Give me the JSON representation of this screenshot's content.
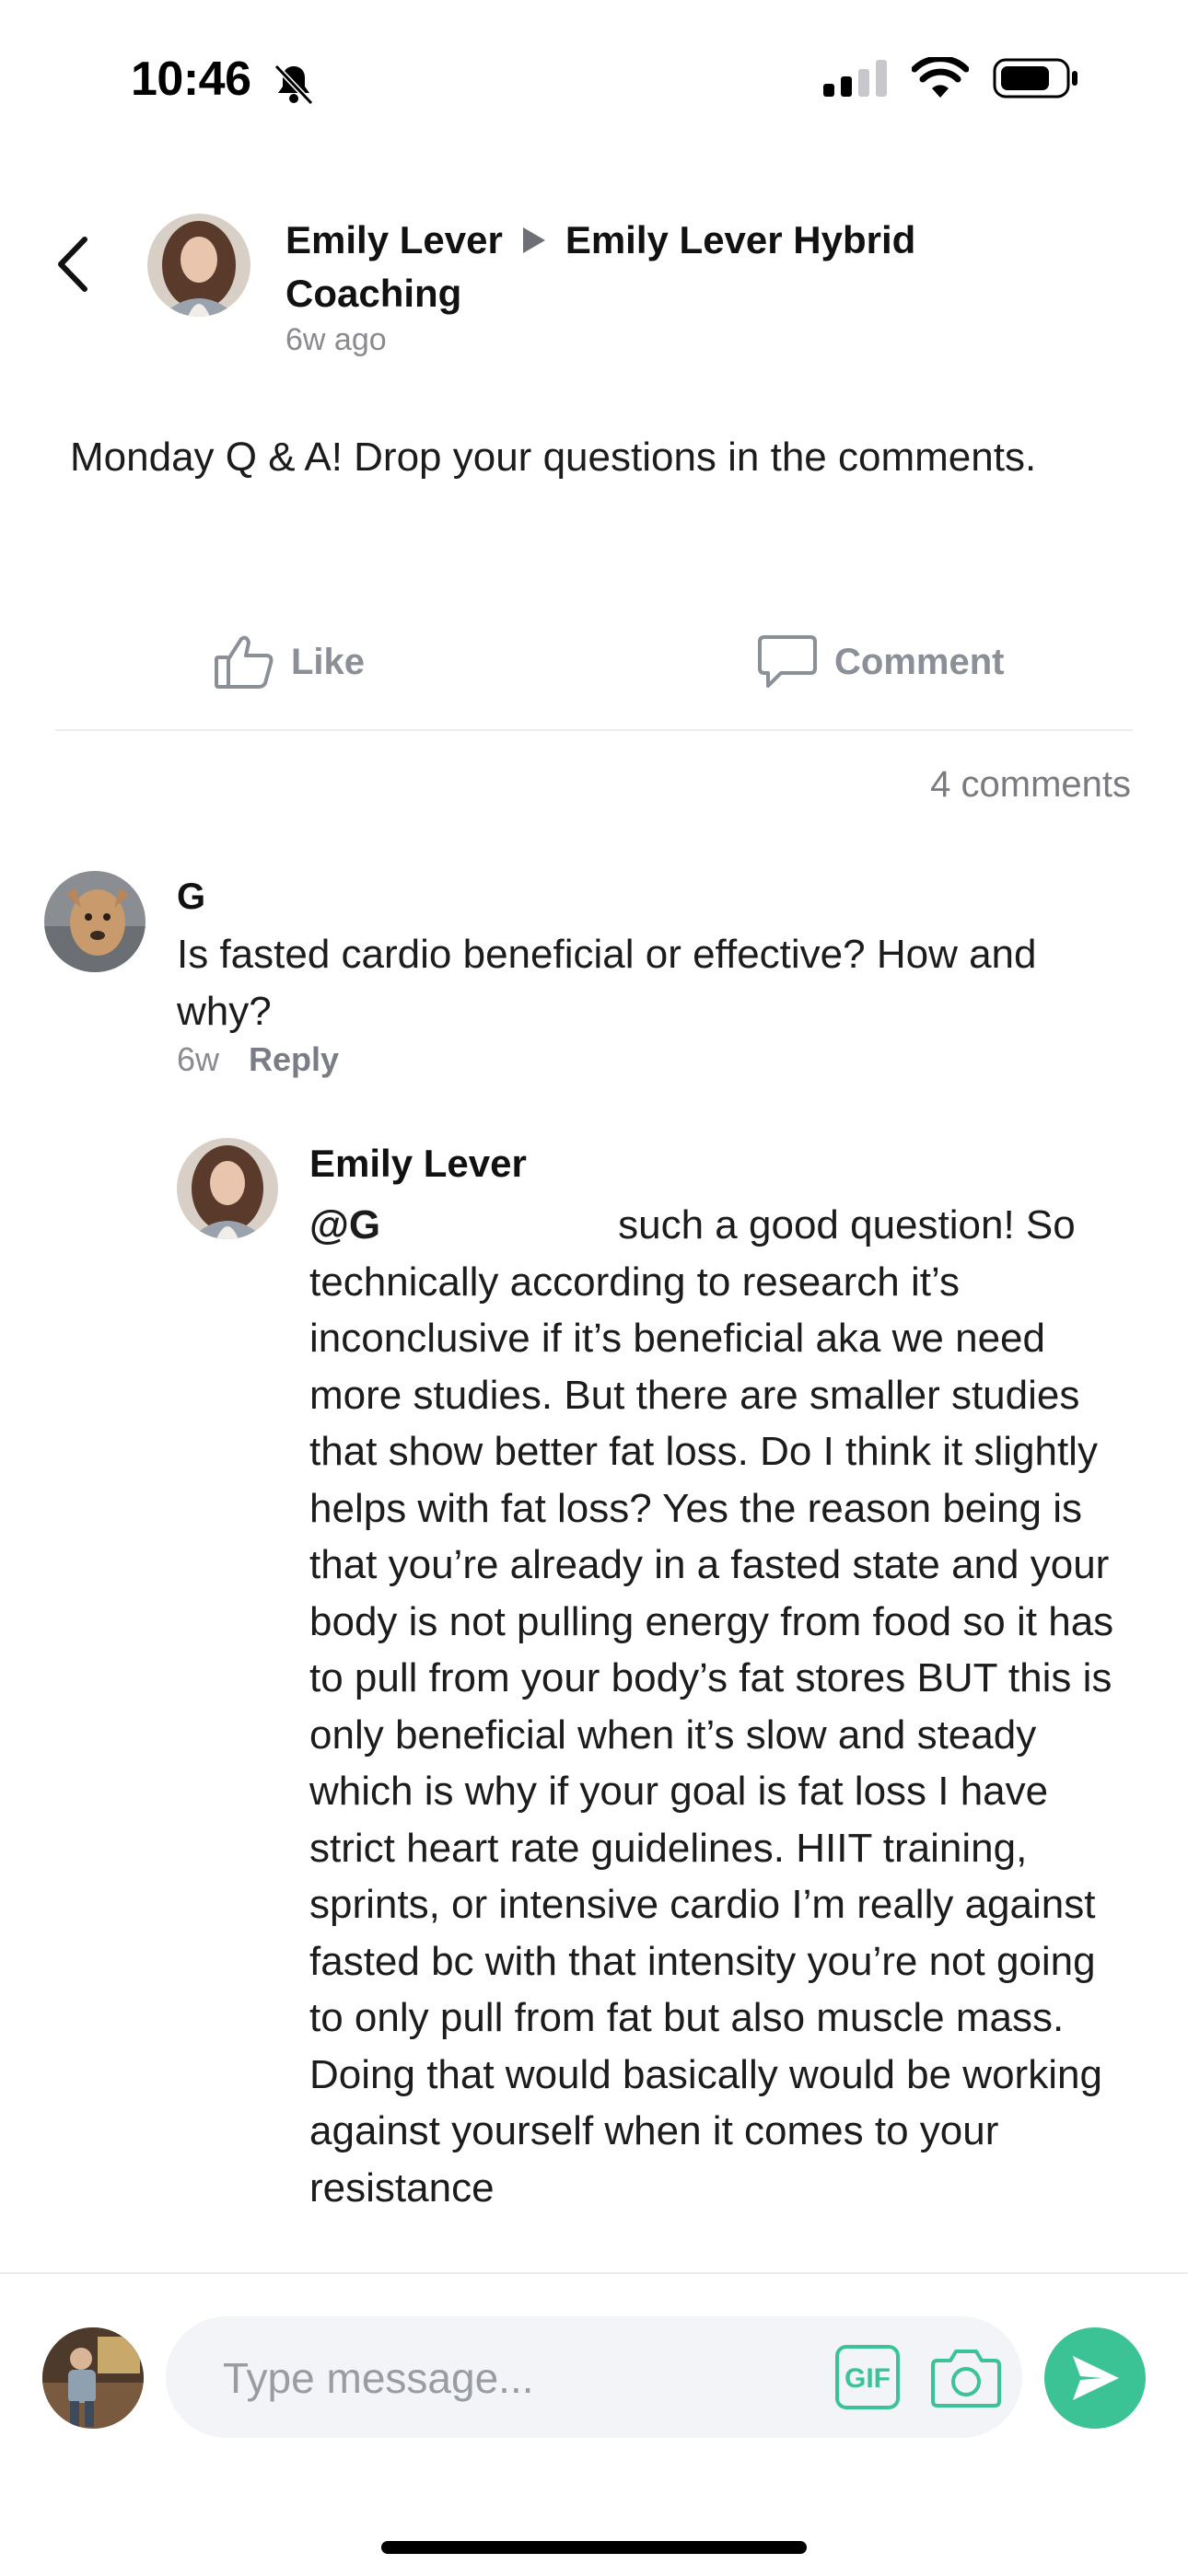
{
  "status_bar": {
    "time": "10:46"
  },
  "post": {
    "author": "Emily Lever",
    "target_group": "Emily Lever Hybrid Coaching",
    "time_ago": "6w ago",
    "body": "Monday Q & A!  Drop your questions in the comments.",
    "like_label": "Like",
    "comment_label": "Comment",
    "comments_count": "4 comments"
  },
  "comments": [
    {
      "author": "G",
      "text": "Is fasted cardio beneficial or effective? How and why?",
      "time": "6w",
      "reply_label": "Reply",
      "replies": [
        {
          "author": "Emily Lever",
          "mention": "@G",
          "text": "such a good question! So technically according to research it’s inconclusive if it’s beneficial aka we need more studies. But there are smaller studies that show better fat loss. Do I think it slightly helps with fat loss? Yes the reason being is that you’re already in a fasted state and your body is not pulling energy from food so it has to pull from your body’s fat stores BUT this is only beneficial when it’s slow and steady which is why if your goal is fat loss I have strict heart rate guidelines. HIIT training, sprints, or intensive cardio I’m really against fasted bc with that intensity you’re not going to only pull from fat but also muscle mass. Doing that would basically would be working against yourself when it comes to your resistance"
        }
      ]
    }
  ],
  "composer": {
    "placeholder": "Type message...",
    "gif_label": "GIF"
  },
  "colors": {
    "accent": "#3cc395",
    "muted": "#8a8f98"
  },
  "icons": [
    "bell-slash-icon",
    "signal-icon",
    "wifi-icon",
    "battery-icon",
    "back-chevron-icon",
    "like-icon",
    "comment-icon",
    "gif-icon",
    "camera-icon",
    "send-icon"
  ]
}
